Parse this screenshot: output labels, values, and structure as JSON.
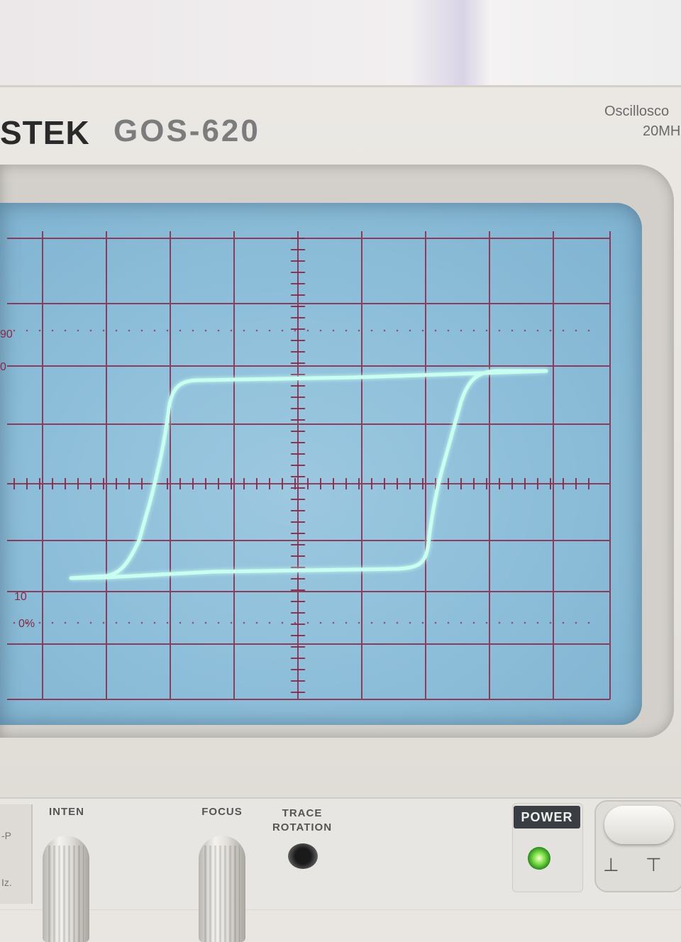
{
  "device": {
    "brand": "STEK",
    "model": "GOS-620",
    "type_label": "Oscillosco",
    "bandwidth_label": "20MH"
  },
  "screen": {
    "percent_label_top": "90",
    "percent_label_top2": "0",
    "percent_label_bottom": "10",
    "percent_label_zero": "0%",
    "trace_color": "#c8fff0",
    "grid_color": "#8a2848"
  },
  "controls": {
    "inten": "INTEN",
    "focus": "FOCUS",
    "trace_rotation_1": "TRACE",
    "trace_rotation_2": "ROTATION",
    "power": "POWER",
    "left_label_1": "-P",
    "left_label_2": "Iz.",
    "power_led_color": "#7fe04a"
  }
}
